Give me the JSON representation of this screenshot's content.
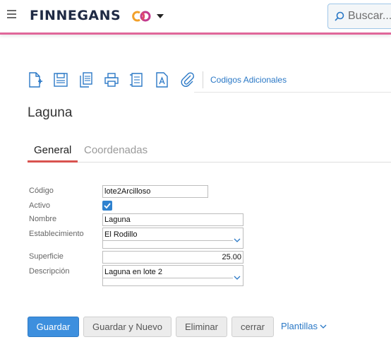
{
  "header": {
    "brand": "FINNEGANS",
    "search_placeholder": "Buscar..."
  },
  "toolbar": {
    "icons": [
      "new-document-icon",
      "save-icon",
      "copy-icon",
      "print-icon",
      "document-list-icon",
      "text-document-icon",
      "attachment-icon"
    ],
    "codigos_label": "Codigos Adicionales"
  },
  "page": {
    "title": "Laguna"
  },
  "tabs": [
    {
      "label": "General",
      "active": true
    },
    {
      "label": "Coordenadas",
      "active": false
    }
  ],
  "form": {
    "codigo": {
      "label": "Código",
      "value": "lote2Arcilloso"
    },
    "activo": {
      "label": "Activo",
      "checked": true
    },
    "nombre": {
      "label": "Nombre",
      "value": "Laguna"
    },
    "establecimiento": {
      "label": "Establecimiento",
      "value": "El Rodillo"
    },
    "superficie": {
      "label": "Superficie",
      "value": "25.00"
    },
    "descripcion": {
      "label": "Descripción",
      "value": "Laguna en lote 2"
    }
  },
  "actions": {
    "guardar": "Guardar",
    "guardar_nuevo": "Guardar y Nuevo",
    "eliminar": "Eliminar",
    "cerrar": "cerrar",
    "plantillas": "Plantillas"
  },
  "colors": {
    "accent_line": "#e0679a",
    "primary_button": "#3d8fde",
    "link": "#2a78c6",
    "active_tab": "#d9534f"
  }
}
